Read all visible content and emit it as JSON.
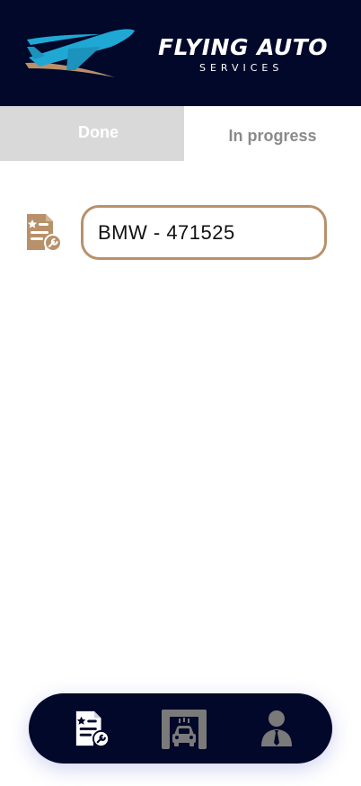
{
  "brand": {
    "title": "FLYING AUTO",
    "subtitle": "SERVICES",
    "colors": {
      "navy": "#01082a",
      "plane_blue": "#1fa8d4",
      "accent_gold": "#b8916a",
      "tab_inactive_bg": "#d9d9d9",
      "nav_icon_active": "#ffffff",
      "nav_icon_inactive": "#7a7a7a"
    }
  },
  "tabs": [
    {
      "label": "Done",
      "selected": false
    },
    {
      "label": "In progress",
      "selected": true
    }
  ],
  "jobs": [
    {
      "label": "BMW - 471525",
      "icon": "job-document-wrench-icon"
    }
  ],
  "bottom_nav": {
    "items": [
      {
        "icon": "jobs-document-icon",
        "active": true
      },
      {
        "icon": "car-wash-icon",
        "active": false
      },
      {
        "icon": "user-profile-icon",
        "active": false
      }
    ]
  }
}
